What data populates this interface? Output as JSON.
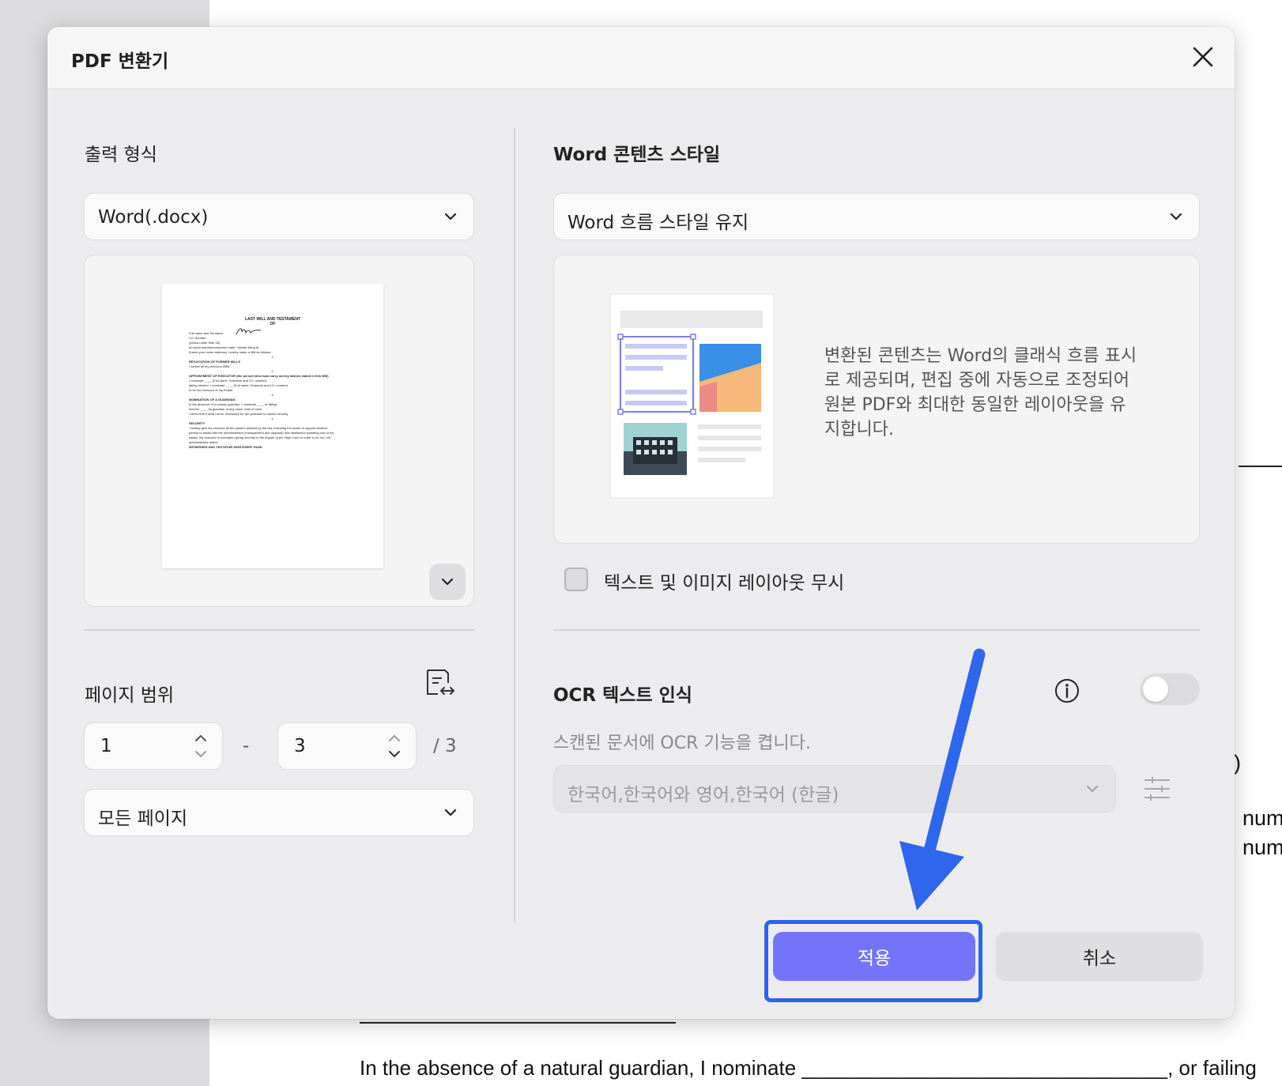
{
  "dialog": {
    "title": "PDF 변환기"
  },
  "left": {
    "output_format_label": "출력 형식",
    "output_format_value": "Word(.docx)",
    "preview": {
      "doc_title": "LAST WILL AND TESTAMENT",
      "doc_of": "OF",
      "doc_lines": [
        "Full name and Surname:",
        "I.D. Number:",
        "(person older than 18)",
        "An adult married/unmarried male / female living at",
        "(Insert your home address), hereby make a Will as follows:",
        "1.",
        "REVOCATION OF FORMER WILLS",
        "I cancel all my previous Wills.",
        "2.",
        "APPOINTMENT OF EXECUTOR (the person who must carry out my wishes stated in this Will)",
        "I nominate ____ (Full name, Surname and I.D. number)",
        "failing him/her, I nominate ____ (Full name, Surname and I.D. number)",
        "to be the executor of my Estate.",
        "3.",
        "NOMINATION OF A GUARDIAN",
        "In the absence of a natural guardian, I nominate ____ or failing",
        "him/her ____ as guardian of any minor child of mine.",
        "I direct that it shall not be necessary for the guardian to furnish security.",
        "4.",
        "SECURITY",
        "I hereby give my executor all the powers allowed by the law, including the power to appoint another",
        "person to assist with the administration (management and disposal) and distribution (handing out) of my",
        "estate. My executor is exempted giving security to the Master of the High Court in order to do his / her",
        "administrative duties.",
        "WITNESSES AND TESTATOR SIGN EVERY PAGE."
      ]
    },
    "page_range_label": "페이지 범위",
    "range_from": "1",
    "range_sep": "-",
    "range_to": "3",
    "range_total": "/ 3",
    "pages_select_value": "모든 페이지"
  },
  "right": {
    "content_style_label": "Word 콘텐츠 스타일",
    "content_style_value": "Word 흐름 스타일 유지",
    "description": "변환된 콘텐츠는 Word의 클래식 흐름 표시로 제공되며, 편집 중에 자동으로 조정되어 원본 PDF와 최대한 동일한 레이아웃을 유지합니다.",
    "ignore_layout_label": "텍스트 및 이미지 레이아웃 무시",
    "ignore_layout_checked": false,
    "ocr_label": "OCR 텍스트 인식",
    "ocr_enabled": false,
    "ocr_hint": "스캔된 문서에 OCR 기능을 켭니다.",
    "ocr_language_value": "한국어,한국어와 영어,한국어 (한글)"
  },
  "footer": {
    "apply_label": "적용",
    "cancel_label": "취소"
  },
  "background_doc": {
    "bottom_line": "In the absence of a natural guardian, I nominate ________________________________, or failing",
    "right_fragments": [
      ")",
      ". num",
      ". num"
    ]
  },
  "colors": {
    "primary": "#7474fb",
    "highlight": "#2b63f0",
    "annotation_arrow": "#2f66ee"
  }
}
